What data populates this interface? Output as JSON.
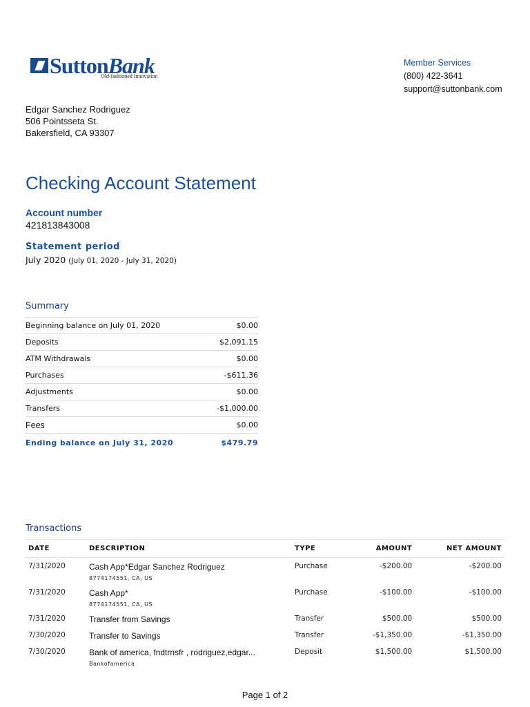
{
  "brand": {
    "name_a": "Sutton",
    "name_b": "Bank",
    "tagline": "Old-fashioned Innovation",
    "color": "#1a4b8c"
  },
  "member_services": {
    "title": "Member Services",
    "phone": "(800) 422-3641",
    "email": "support@suttonbank.com"
  },
  "address": {
    "name": "Edgar Sanchez Rodriguez",
    "street": "506 Pointsseta St.",
    "city": "Bakersfield, CA 93307"
  },
  "title": "Checking Account Statement",
  "account": {
    "label": "Account number",
    "value": "421813843008"
  },
  "period": {
    "label": "Statement period",
    "month": "July 2020",
    "range": "(July 01, 2020 - July 31, 2020)"
  },
  "summary": {
    "title": "Summary",
    "rows": [
      {
        "label": "Beginning balance on July 01, 2020",
        "value": "$0.00"
      },
      {
        "label": "Deposits",
        "value": "$2,091.15"
      },
      {
        "label": "ATM Withdrawals",
        "value": "$0.00"
      },
      {
        "label": "Purchases",
        "value": "-$611.36"
      },
      {
        "label": "Adjustments",
        "value": "$0.00"
      },
      {
        "label": "Transfers",
        "value": "-$1,000.00"
      },
      {
        "label": "Fees",
        "value": "$0.00"
      }
    ],
    "ending": {
      "label": "Ending balance on July 31, 2020",
      "value": "$479.79"
    }
  },
  "transactions": {
    "title": "Transactions",
    "headers": [
      "DATE",
      "DESCRIPTION",
      "TYPE",
      "AMOUNT",
      "NET AMOUNT"
    ],
    "rows": [
      {
        "date": "7/31/2020",
        "desc": "Cash App*Edgar Sanchez Rodriguez",
        "sub": "8774174551, CA, US",
        "type": "Purchase",
        "amount": "-$200.00",
        "net": "-$200.00"
      },
      {
        "date": "7/31/2020",
        "desc": "Cash App*",
        "sub": "8774174551, CA, US",
        "type": "Purchase",
        "amount": "-$100.00",
        "net": "-$100.00"
      },
      {
        "date": "7/31/2020",
        "desc": "Transfer from Savings",
        "sub": "",
        "type": "Transfer",
        "amount": "$500.00",
        "net": "$500.00"
      },
      {
        "date": "7/30/2020",
        "desc": "Transfer to Savings",
        "sub": "",
        "type": "Transfer",
        "amount": "-$1,350.00",
        "net": "-$1,350.00"
      },
      {
        "date": "7/30/2020",
        "desc": "Bank of america, fndtrnsfr , rodriguez,edgar...",
        "sub": "Bankofamerica",
        "type": "Deposit",
        "amount": "$1,500.00",
        "net": "$1,500.00"
      }
    ]
  },
  "footer": "Page 1 of 2"
}
